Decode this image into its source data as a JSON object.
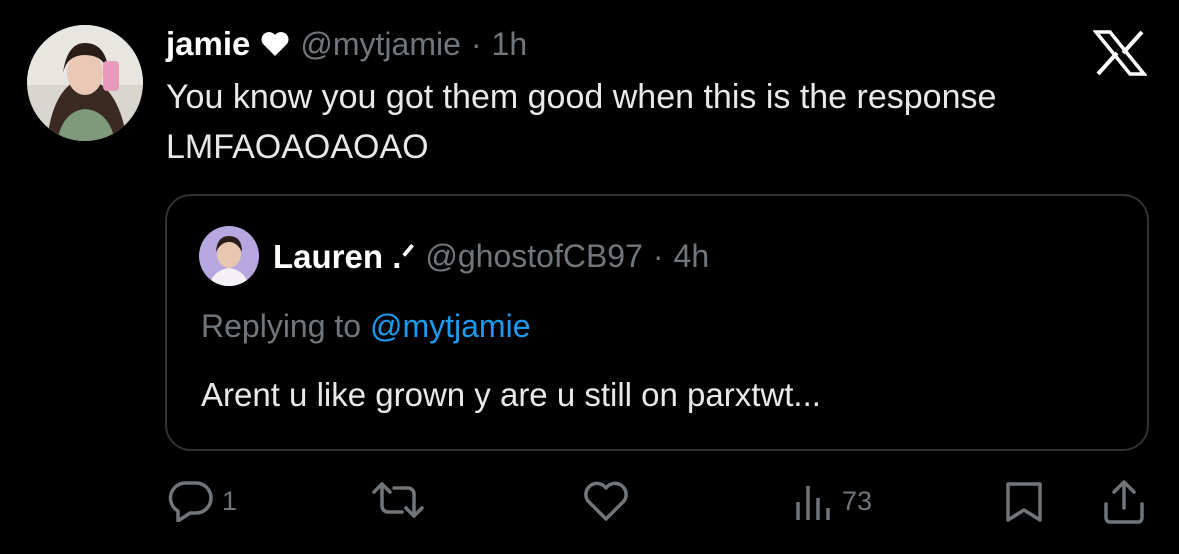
{
  "tweet": {
    "author_name": "jamie",
    "handle": "@mytjamie",
    "separator": "·",
    "time": "1h",
    "text": "You know you got them good when this is the response\nLMFAOAOAOAO"
  },
  "quoted": {
    "author_name": "Lauren .ᐟ",
    "handle": "@ghostofCB97",
    "separator": "·",
    "time": "4h",
    "replying_prefix": "Replying to",
    "replying_handle": "@mytjamie",
    "text": "Arent u like grown y are u still on parxtwt..."
  },
  "actions": {
    "reply_count": "1",
    "views_count": "73"
  },
  "icons": [
    "heart-emoji-icon",
    "x-logo-icon",
    "reply-icon",
    "retweet-icon",
    "like-icon",
    "views-icon",
    "bookmark-icon",
    "share-icon"
  ],
  "colors": {
    "background": "#000000",
    "text": "#e7e9ea",
    "muted": "#71767b",
    "link": "#1d9bf0",
    "border": "#2f3336"
  }
}
